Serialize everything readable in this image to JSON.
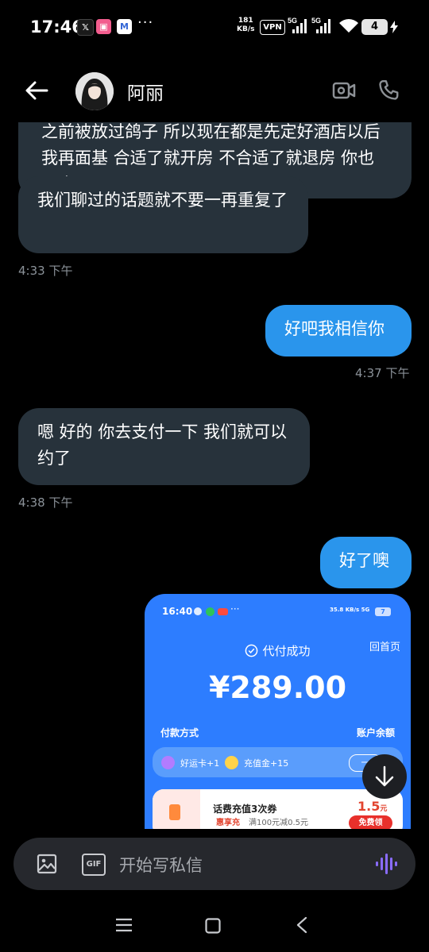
{
  "status_bar": {
    "time": "17:46",
    "app_icons": [
      "x-icon",
      "bilibili-icon",
      "mail-icon"
    ],
    "overflow": "···",
    "net_speed_value": "181",
    "net_speed_unit": "KB/s",
    "vpn": "VPN",
    "network": [
      "5G",
      "5G"
    ],
    "battery": "4"
  },
  "header": {
    "contact_name": "阿丽"
  },
  "messages": [
    {
      "dir": "in",
      "text": "之前被放过鸽子 所以现在都是先定好酒店以后我再面基 合适了就开房 不合适了就退房 你也不会..."
    },
    {
      "dir": "in",
      "text": "我们聊过的话题就不要一再重复了"
    },
    {
      "time": "4:33 下午"
    },
    {
      "dir": "out",
      "text": "好吧我相信你"
    },
    {
      "time": "4:37 下午"
    },
    {
      "dir": "in",
      "text": "嗯 好的 你去支付一下 我们就可以约了"
    },
    {
      "time": "4:38 下午"
    },
    {
      "dir": "out",
      "text": "好了噢"
    }
  ],
  "screenshot": {
    "time": "16:40",
    "status_icons": "35.8 KB/s 5G",
    "battery": "7",
    "title": "代付成功",
    "home": "回首页",
    "amount": "¥289.00",
    "pay_method": "付款方式",
    "balance": "账户余额",
    "promo1": "好运卡+1",
    "promo2": "充值金+15",
    "promo3": "一",
    "offer_title": "话费充值3次券",
    "offer_tag": "惠享充",
    "offer_desc": "满100元减0.5元",
    "offer_price": "1.5",
    "offer_price_unit": "元",
    "offer_button": "免费领"
  },
  "composer": {
    "gif": "GIF",
    "placeholder": "开始写私信"
  },
  "colors": {
    "incoming_bubble": "#27323b",
    "outgoing_bubble": "#2a95ec",
    "screenshot_bg": "#2d7dff",
    "voice_icon": "#8a6cff"
  }
}
